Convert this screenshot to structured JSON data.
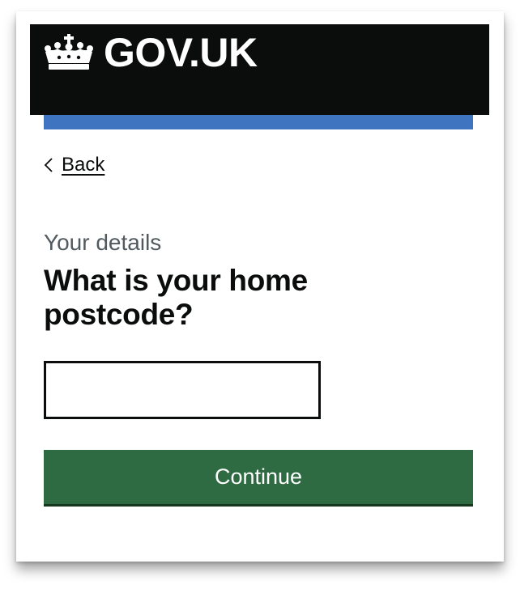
{
  "header": {
    "logo_text": "GOV.UK",
    "logo_icon": "crown-icon",
    "background_color": "#0b0c0c"
  },
  "service_bar": {
    "color": "#3f74c0"
  },
  "navigation": {
    "back_label": "Back",
    "back_icon": "chevron-left-icon"
  },
  "form": {
    "caption": "Your details",
    "question": "What is your home postcode?",
    "postcode_input": {
      "value": "",
      "placeholder": ""
    },
    "continue_label": "Continue",
    "continue_color": "#2f6b42"
  }
}
